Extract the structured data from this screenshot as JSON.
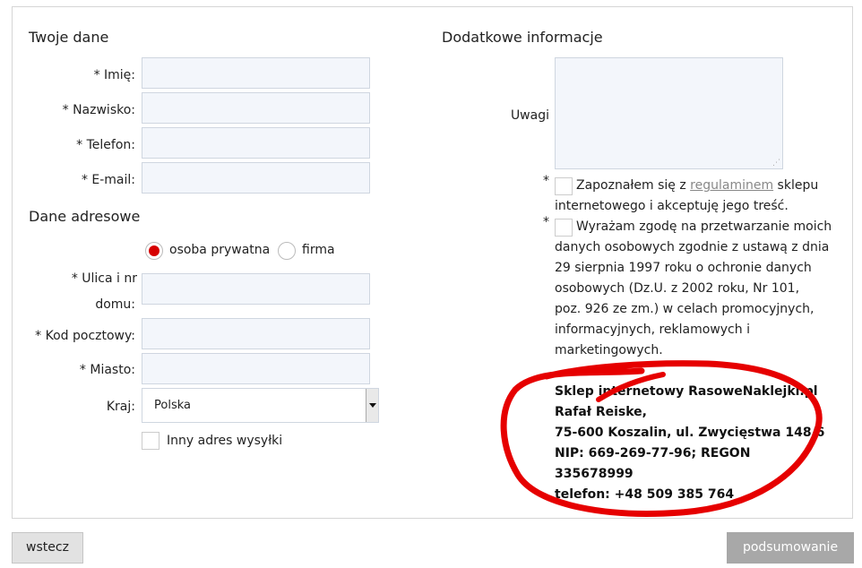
{
  "personal": {
    "title": "Twoje dane",
    "fields": [
      {
        "label": "* Imię:"
      },
      {
        "label": "* Nazwisko:"
      },
      {
        "label": "* Telefon:"
      },
      {
        "label": "* E-mail:"
      }
    ]
  },
  "address": {
    "title": "Dane adresowe",
    "radio_private": "osoba prywatna",
    "radio_company": "firma",
    "street_line1": "* Ulica i nr",
    "street_line2": "domu:",
    "postal": "* Kod pocztowy:",
    "city": "* Miasto:",
    "country_label": "Kraj:",
    "country_value": "Polska",
    "other_shipping": "Inny adres wysyłki"
  },
  "extra": {
    "title": "Dodatkowe informacje",
    "notes_label": "Uwagi",
    "consent1_prefix": "Zapoznałem się z ",
    "consent1_link": "regulaminem",
    "consent1_suffix": " sklepu",
    "consent1_line2": "internetowego i akceptuję jego treść.",
    "consent2_lines": [
      "Wyrażam zgodę na przetwarzanie moich",
      "danych osobowych zgodnie z ustawą z dnia",
      "29 sierpnia 1997 roku o ochronie danych",
      "osobowych (Dz.U. z 2002 roku, Nr 101,",
      "poz. 926 ze zm.) w celach promocyjnych,",
      "informacyjnych, reklamowych i",
      "marketingowych."
    ],
    "required_mark": "*"
  },
  "shop": {
    "lines": [
      "Sklep internetowy RasoweNaklejki.pl",
      "Rafał Reiske,",
      "75-600 Koszalin, ul. Zwycięstwa 148/6",
      "NIP: 669-269-77-96; REGON",
      "335678999",
      "telefon: +48 509 385 764"
    ]
  },
  "buttons": {
    "back": "wstecz",
    "next": "podsumowanie"
  },
  "colors": {
    "annotation": "#e60000",
    "radio_selected": "#d60000",
    "next_button": "#a8a8a8"
  }
}
